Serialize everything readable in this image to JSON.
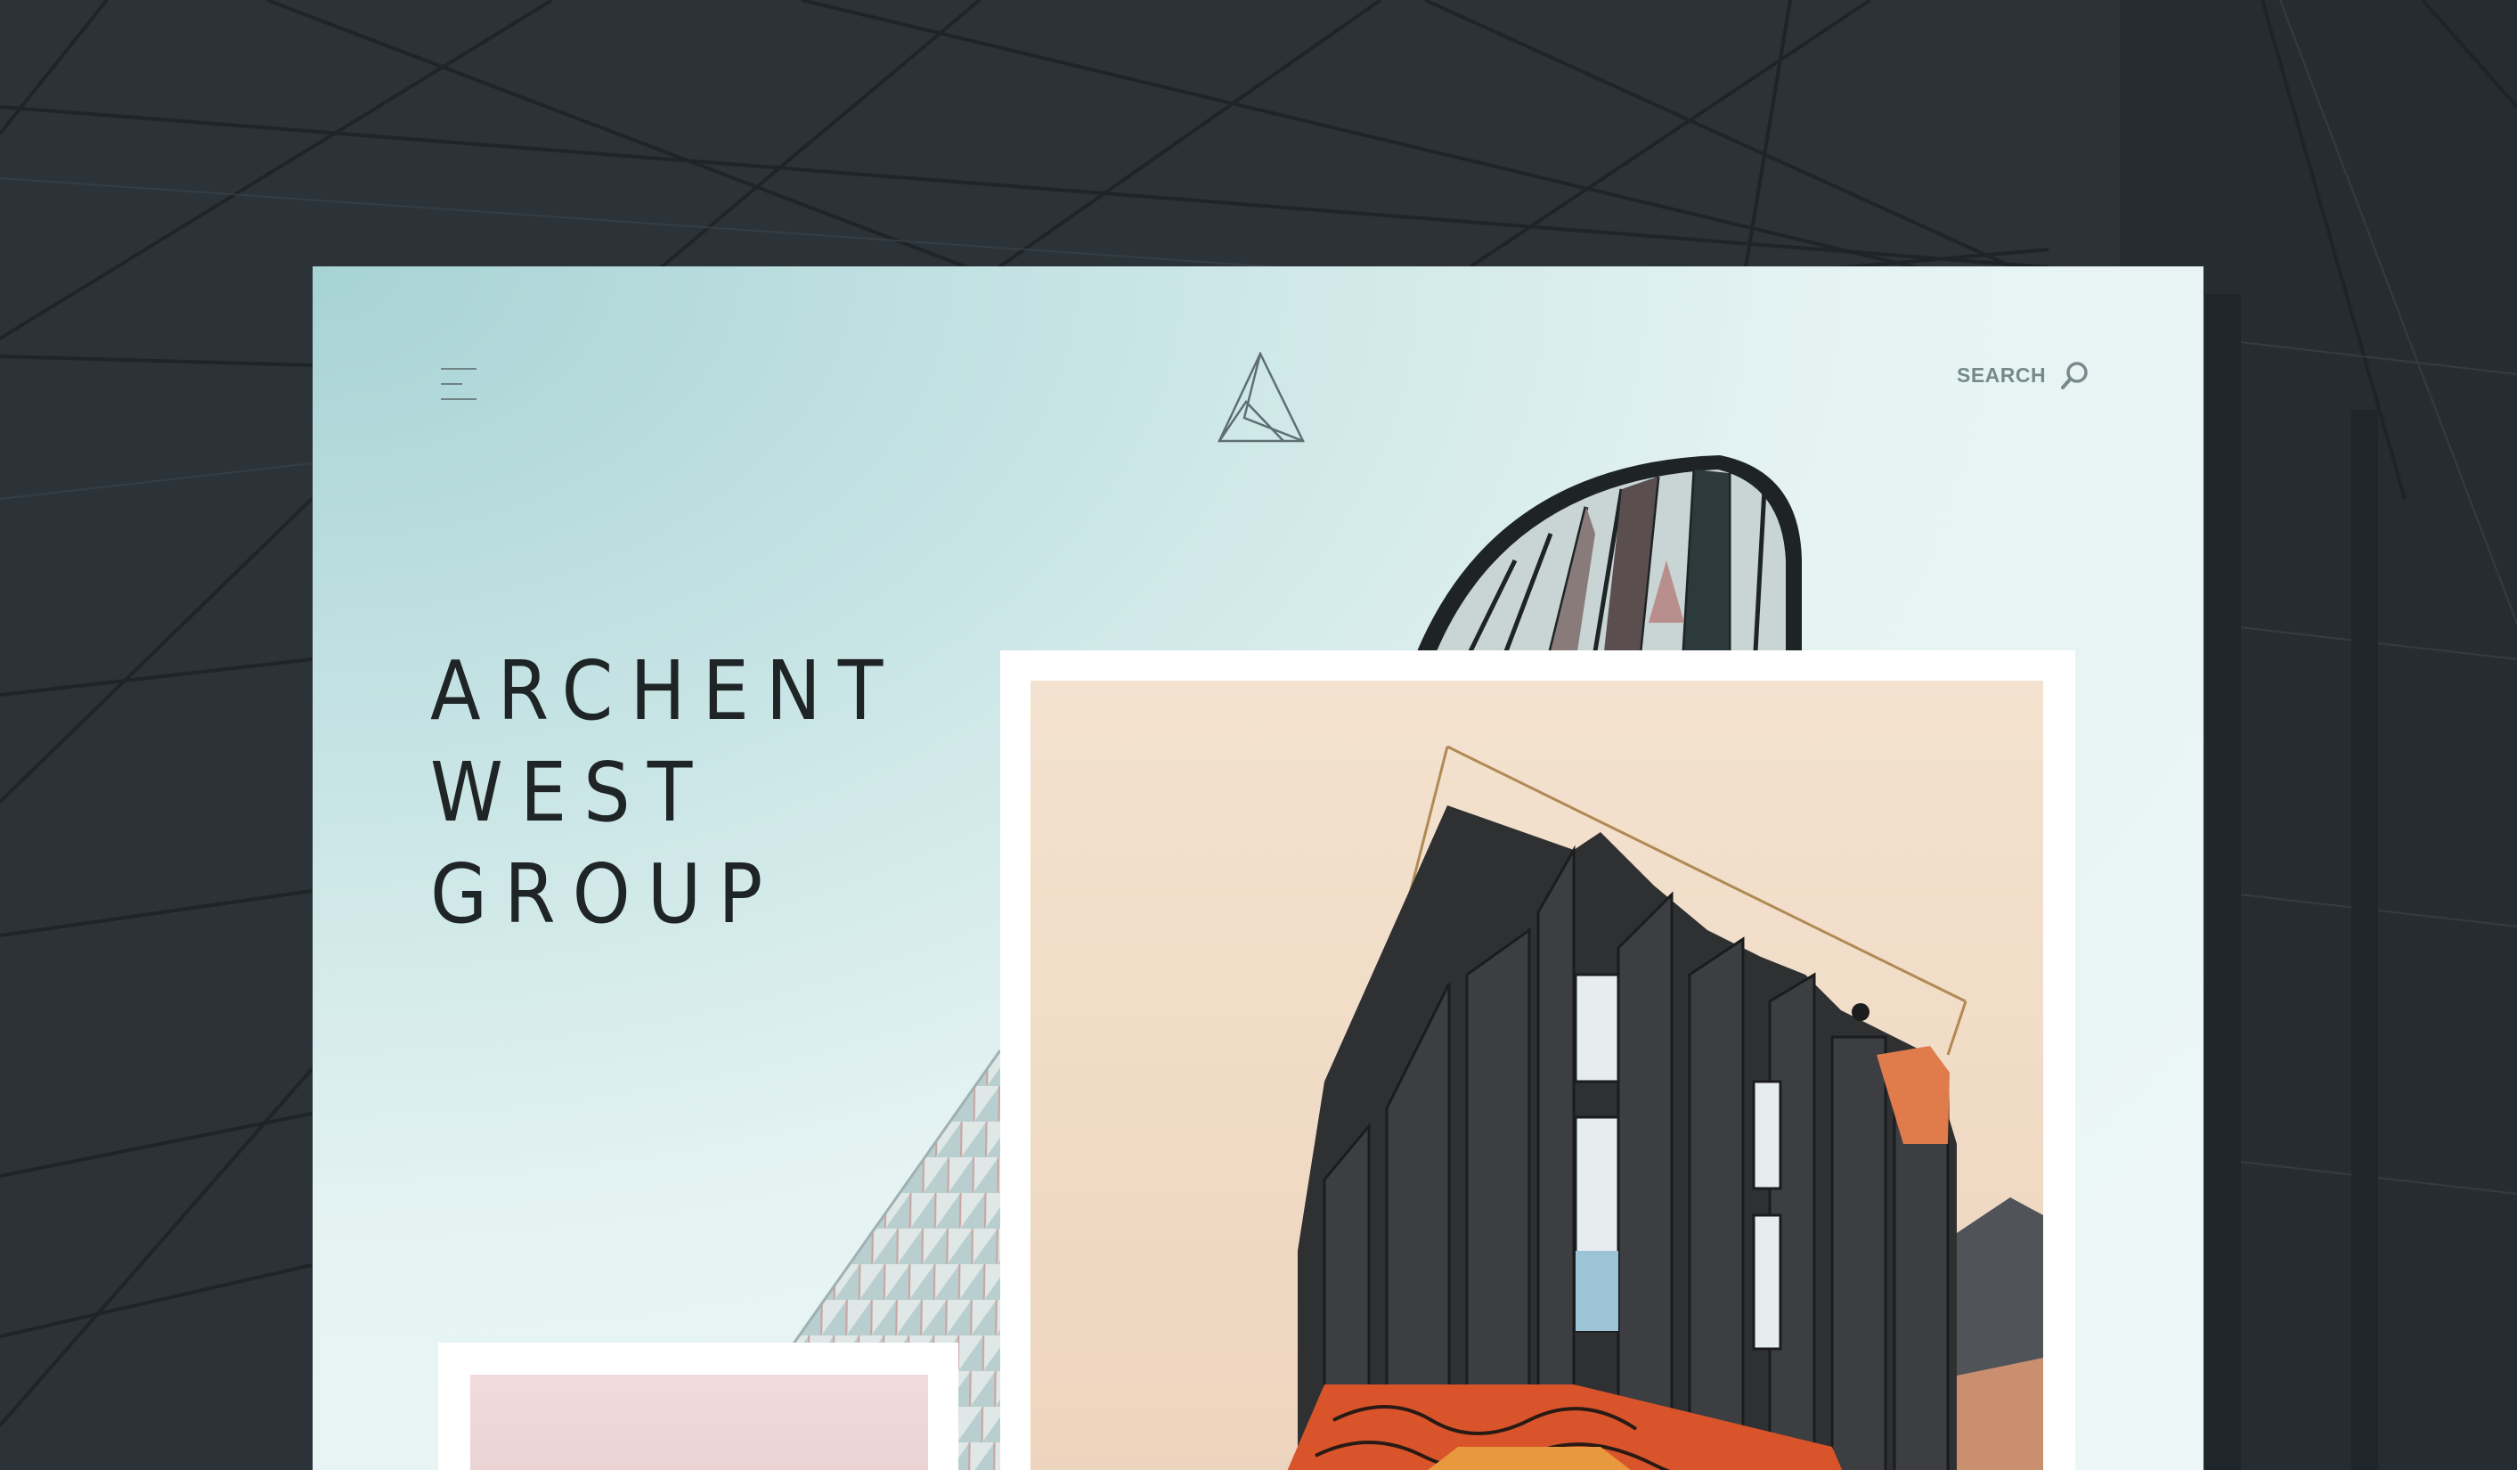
{
  "header": {
    "menu_icon": "hamburger-menu-icon",
    "logo_icon": "triangle-a-logo-icon",
    "search_label": "SEARCH",
    "search_icon": "magnifier-icon"
  },
  "hero": {
    "headline_lines": [
      "ARCHENT",
      "WEST",
      "GROUP"
    ]
  },
  "images": {
    "background": "architecture-structure-photo",
    "featured": "black-panel-building-photo",
    "secondary": "pink-sky-photo"
  },
  "colors": {
    "card_tint": "#c6e3e4",
    "page_dark": "#2b3339",
    "ui_grey": "#76898b",
    "headline": "#1f2426"
  }
}
